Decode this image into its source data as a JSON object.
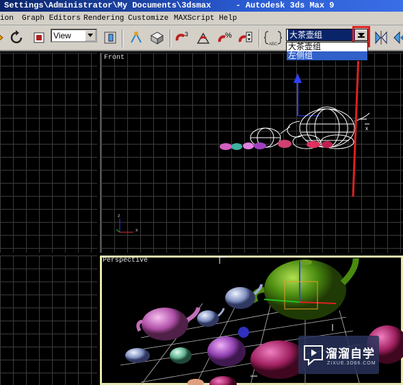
{
  "window": {
    "title": "Settings\\Administrator\\My Documents\\3dsmax     - Autodesk 3ds Max 9"
  },
  "menu": {
    "items": [
      "ion",
      "Graph Editors",
      "Rendering",
      "Customize",
      "MAXScript",
      "Help"
    ]
  },
  "toolbar": {
    "reference_coord_dropdown": "View",
    "named_selection_set": {
      "selected": "大茶壶组",
      "options": [
        "大茶壶组",
        "左侧组"
      ],
      "highlighted_index": 1
    }
  },
  "viewports": {
    "front": {
      "label": "Front"
    },
    "perspective": {
      "label": "Perspective"
    }
  },
  "watermark": {
    "text": "溜溜自学",
    "subtext": "ZIXUE.3D66.COM"
  },
  "colors": {
    "titlebar": "#0a246a",
    "highlight_red": "#e02020",
    "selection_blue": "#3060c8"
  }
}
